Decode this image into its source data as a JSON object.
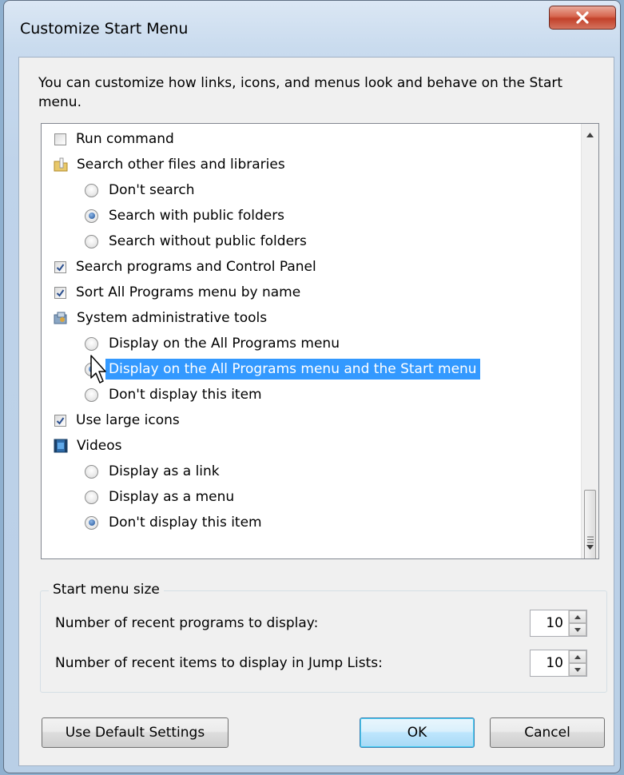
{
  "window": {
    "title": "Customize Start Menu",
    "close_glyph": "X"
  },
  "intro_text": "You can customize how links, icons, and menus look and behave on the Start menu.",
  "list": {
    "run_command": "Run command",
    "search_other": "Search other files and libraries",
    "dont_search": "Don't search",
    "search_public": "Search with public folders",
    "search_without_public": "Search without public folders",
    "search_programs": "Search programs and Control Panel",
    "sort_all_programs": "Sort All Programs menu by name",
    "sys_admin_tools": "System administrative tools",
    "admin_all_programs": "Display on the All Programs menu",
    "admin_all_programs_start": "Display on the All Programs menu and the Start menu",
    "admin_dont_display": "Don't display this item",
    "use_large_icons": "Use large icons",
    "videos": "Videos",
    "videos_link": "Display as a link",
    "videos_menu": "Display as a menu",
    "videos_dont_display": "Don't display this item"
  },
  "start_menu_size": {
    "group_label": "Start menu size",
    "recent_programs_label": "Number of recent programs to display:",
    "recent_programs_value": "10",
    "jump_list_label": "Number of recent items to display in Jump Lists:",
    "jump_list_value": "10"
  },
  "buttons": {
    "default_settings": "Use Default Settings",
    "ok": "OK",
    "cancel": "Cancel"
  },
  "colors": {
    "selection": "#3399ff",
    "close_button": "#c2412a"
  }
}
